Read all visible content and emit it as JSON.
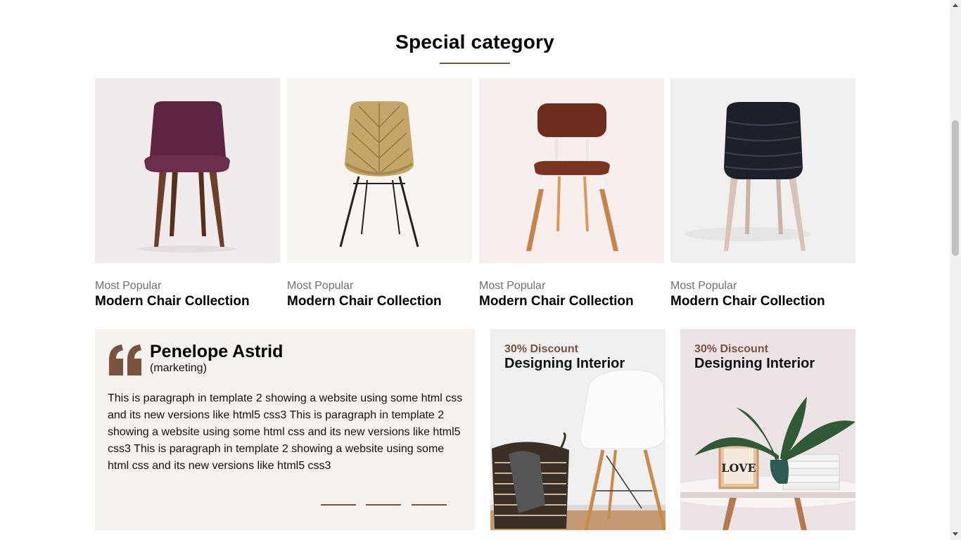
{
  "section": {
    "title": "Special category"
  },
  "products": [
    {
      "subtitle": "Most Popular",
      "title": "Modern Chair Collection",
      "bg": "#f1ebec",
      "seat_color": "#5e2540",
      "icon": "purple-upholstered-chair"
    },
    {
      "subtitle": "Most Popular",
      "title": "Modern Chair Collection",
      "bg": "#f8f4ef",
      "seat_color": "#b89a5e",
      "icon": "rattan-wire-chair"
    },
    {
      "subtitle": "Most Popular",
      "title": "Modern Chair Collection",
      "bg": "#f8eeeb",
      "seat_color": "#6e2e1d",
      "icon": "leather-wood-chair"
    },
    {
      "subtitle": "Most Popular",
      "title": "Modern Chair Collection",
      "bg": "#f1f0ee",
      "seat_color": "#1b2029",
      "icon": "black-quilted-chair"
    }
  ],
  "testimonial": {
    "name": "Penelope Astrid",
    "role": "(marketing)",
    "text": "This is paragraph in template 2 showing a website using some html css and its new versions like html5 css3 This is paragraph in template 2 showing a website using some html css and its new versions like html5 css3 This is paragraph in template 2 showing a website using some html css and its new versions like html5 css3",
    "slides": 3
  },
  "promos": [
    {
      "discount": "30% Discount",
      "title": "Designing Interior",
      "icon": "white-chair-basket-photo"
    },
    {
      "discount": "30% Discount",
      "title": "Designing Interior",
      "icon": "plant-love-table-photo"
    }
  ],
  "colors": {
    "accent": "#7a5240",
    "testimonial_bg": "#f5f1ec"
  }
}
